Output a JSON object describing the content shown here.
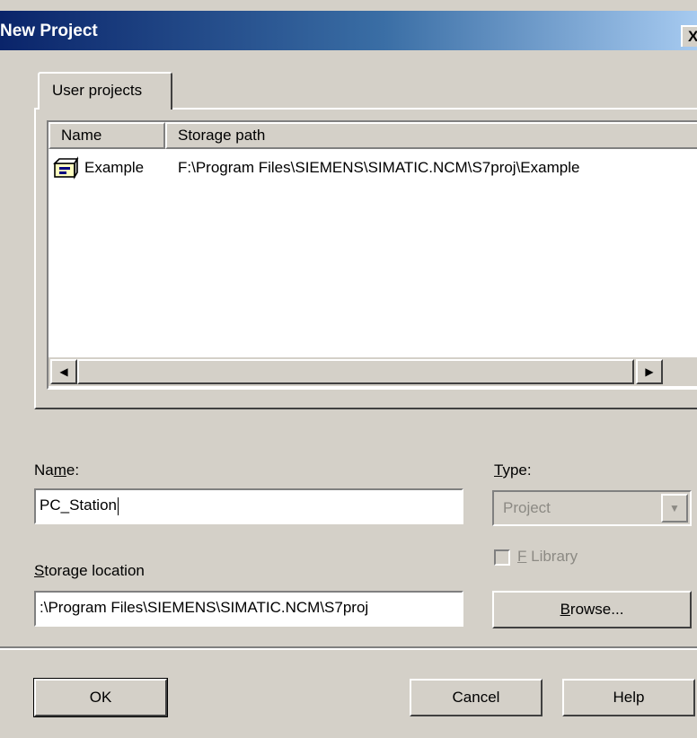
{
  "window": {
    "title": "New Project",
    "close_glyph": "X"
  },
  "tabs": [
    {
      "label": "User projects"
    }
  ],
  "project_list": {
    "columns": [
      {
        "label": "Name"
      },
      {
        "label": "Storage path"
      }
    ],
    "rows": [
      {
        "name": "Example",
        "path": "F:\\Program Files\\SIEMENS\\SIMATIC.NCM\\S7proj\\Example",
        "icon": "project-icon"
      }
    ],
    "scroll_left_glyph": "◀",
    "scroll_right_glyph": "▶"
  },
  "form": {
    "name_label": {
      "pre": "Na",
      "accel": "m",
      "post": "e:"
    },
    "name_value": "PC_Station",
    "type_label": {
      "accel": "T",
      "post": "ype:"
    },
    "type_value": "Project",
    "flibrary_label": {
      "accel": "F",
      "post": " Library"
    },
    "storage_label": {
      "accel": "S",
      "post": "torage location"
    },
    "storage_value": ":\\Program Files\\SIEMENS\\SIMATIC.NCM\\S7proj",
    "browse_label": {
      "accel": "B",
      "post": "rowse..."
    }
  },
  "buttons": {
    "ok": "OK",
    "cancel": "Cancel",
    "help": "Help"
  },
  "colors": {
    "titlebar_start": "#0a246a",
    "titlebar_end": "#a6caf0",
    "dialog_bg": "#d4d0c8"
  }
}
